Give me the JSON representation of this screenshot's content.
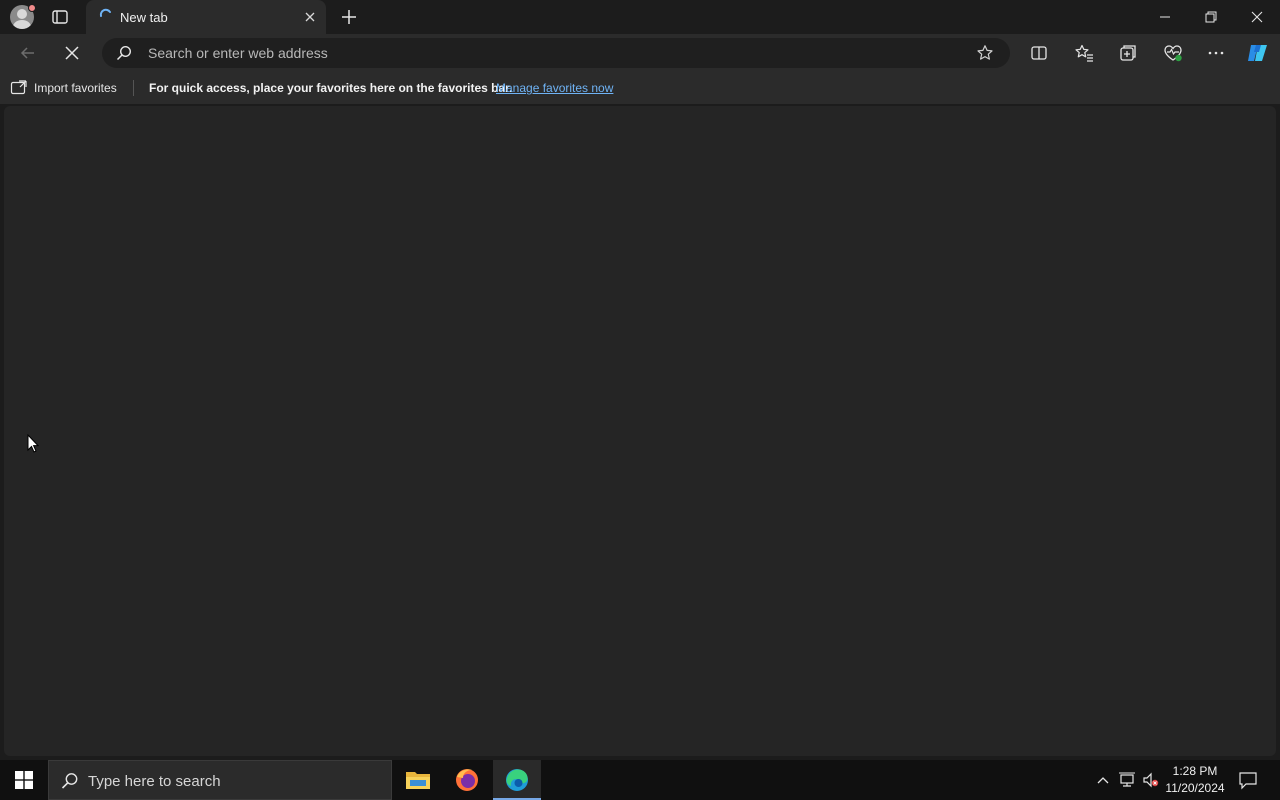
{
  "tab": {
    "title": "New tab"
  },
  "address": {
    "placeholder": "Search or enter web address",
    "value": ""
  },
  "favorites_bar": {
    "import_label": "Import favorites",
    "message": "For quick access, place your favorites here on the favorites bar.",
    "manage_link": "Manage favorites now"
  },
  "taskbar": {
    "search_placeholder": "Type here to search",
    "time": "1:28 PM",
    "date": "11/20/2024"
  },
  "colors": {
    "link": "#6fb3f5",
    "active_indicator": "#77a8e6",
    "content_bg": "#252525"
  }
}
